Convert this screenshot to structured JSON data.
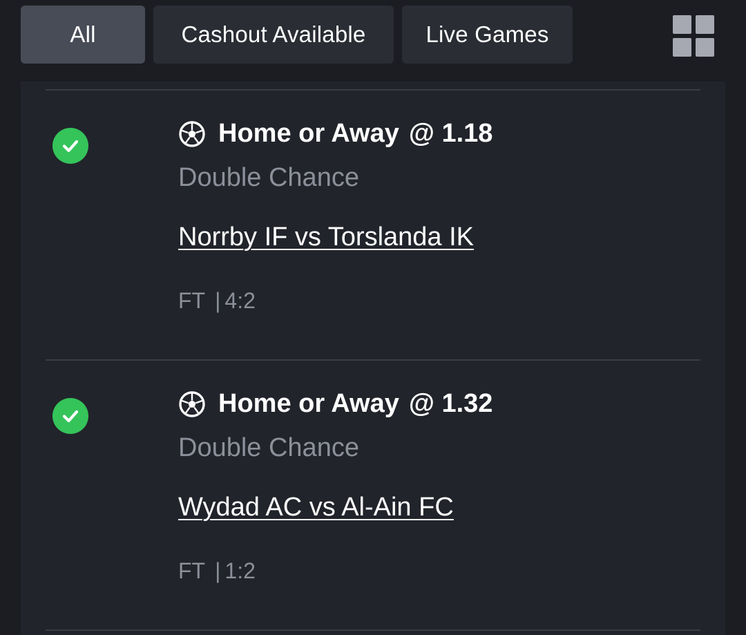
{
  "filters": {
    "tabs": [
      {
        "label": "All",
        "active": true
      },
      {
        "label": "Cashout Available",
        "active": false
      },
      {
        "label": "Live Games",
        "active": false
      }
    ],
    "view_toggle_icon": "grid-icon"
  },
  "colors": {
    "background": "#1b1d22",
    "panel": "#22242b",
    "active_tab": "#484c56",
    "tab": "#2a2d34",
    "won_status": "#34c45a",
    "muted_text": "#8c909a"
  },
  "bets": [
    {
      "status": "won",
      "status_icon": "check-circle-icon",
      "sport_icon": "soccer-ball-icon",
      "selection": "Home or Away",
      "odds_text": "@ 1.18",
      "market": "Double Chance",
      "event": "Norrby IF vs Torslanda IK",
      "period": "FT",
      "separator": "|",
      "score": "4:2"
    },
    {
      "status": "won",
      "status_icon": "check-circle-icon",
      "sport_icon": "soccer-ball-icon",
      "selection": "Home or Away",
      "odds_text": "@ 1.32",
      "market": "Double Chance",
      "event": "Wydad AC vs Al-Ain FC",
      "period": "FT",
      "separator": "|",
      "score": "1:2"
    }
  ]
}
